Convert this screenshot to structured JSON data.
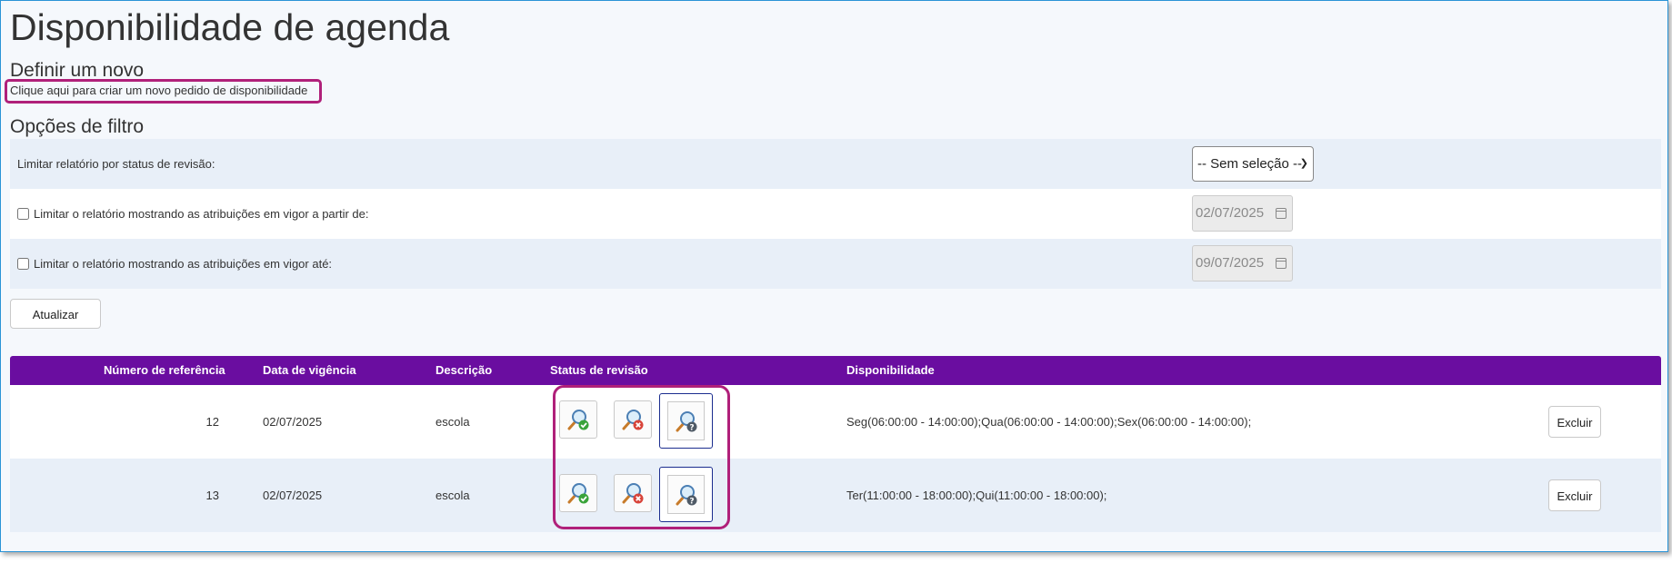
{
  "page": {
    "title": "Disponibilidade de agenda"
  },
  "create": {
    "heading": "Definir um novo",
    "link_text": "Clique aqui para criar um novo pedido de disponibilidade"
  },
  "filters": {
    "heading": "Opções de filtro",
    "status_label": "Limitar relatório por status de revisão:",
    "status_selected": "-- Sem seleção --",
    "from_label": "Limitar o relatório mostrando as atribuições em vigor a partir de:",
    "from_date": "02/07/2025",
    "until_label": "Limitar o relatório mostrando as atribuições em vigor até:",
    "until_date": "09/07/2025",
    "update_label": "Atualizar"
  },
  "table": {
    "columns": [
      "Número de referência",
      "Data de vigência",
      "Descrição",
      "Status de revisão",
      "Disponibilidade"
    ],
    "rows": [
      {
        "ref": "12",
        "date": "02/07/2025",
        "desc": "escola",
        "availability": "Seg(06:00:00 - 14:00:00);Qua(06:00:00 - 14:00:00);Sex(06:00:00 - 14:00:00);",
        "delete_label": "Excluir"
      },
      {
        "ref": "13",
        "date": "02/07/2025",
        "desc": "escola",
        "availability": "Ter(11:00:00 - 18:00:00);Qui(11:00:00 - 18:00:00);",
        "delete_label": "Excluir"
      }
    ]
  },
  "icons": {
    "approve": "review-approve-icon",
    "reject": "review-reject-icon",
    "pending": "review-pending-icon"
  },
  "colors": {
    "header_bg": "#6a0da0",
    "highlight": "#b0207a",
    "row_shade": "#e8eff8",
    "frame_border": "#2a93d6"
  }
}
